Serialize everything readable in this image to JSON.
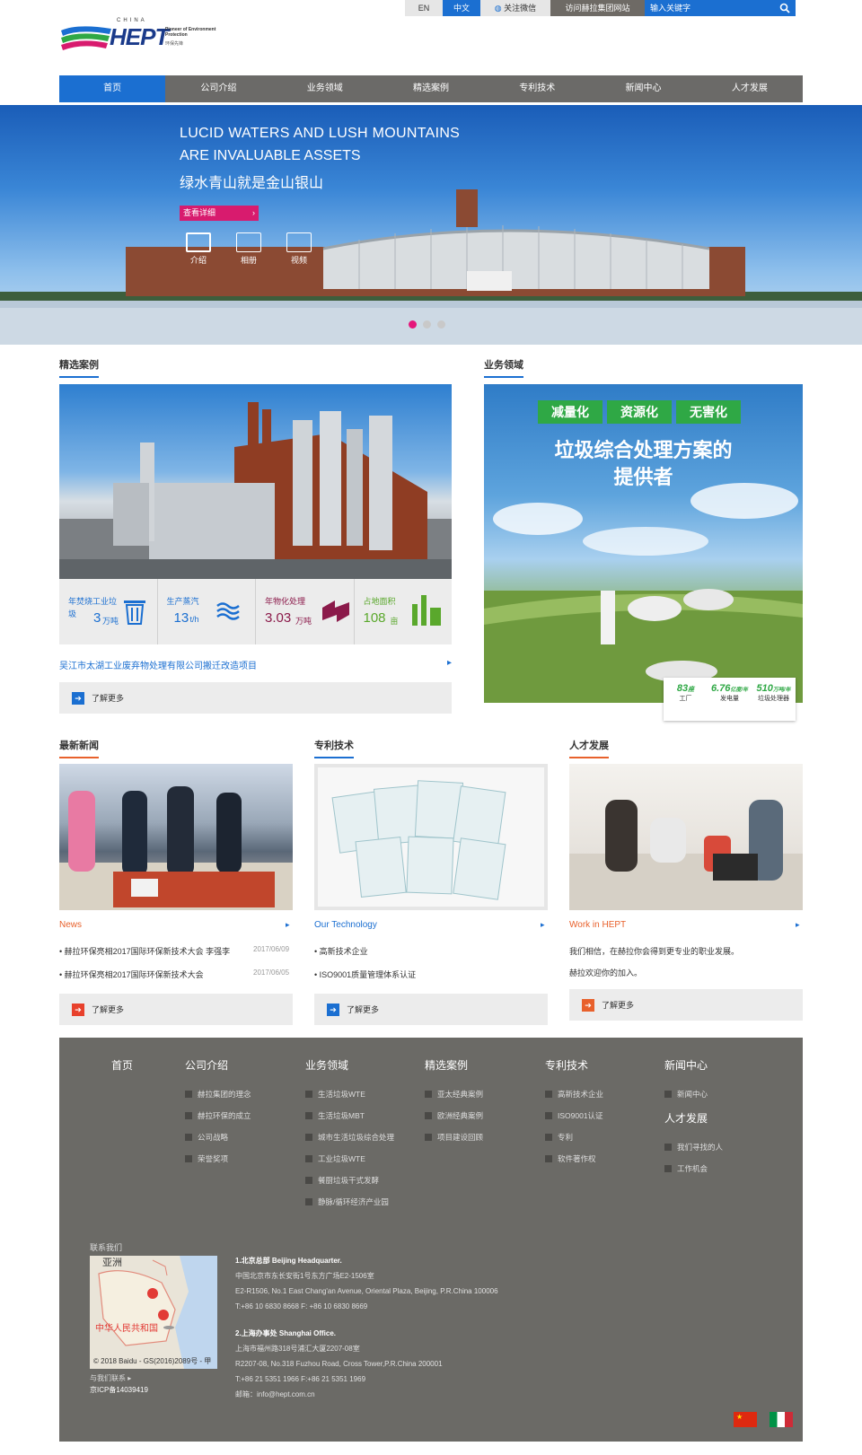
{
  "topbar": {
    "lang_en": "EN",
    "lang_zh": "中文",
    "wechat": "关注微信",
    "visit_group": "访问赫拉集团网站",
    "search_placeholder": "输入关键字"
  },
  "logo": {
    "brand": "HEPT",
    "country": "CHINA",
    "tagline": "Pioneer of Environment Protection",
    "tagline_cn": "环保先锋"
  },
  "nav": [
    "首页",
    "公司介绍",
    "业务领域",
    "精选案例",
    "专利技术",
    "新闻中心",
    "人才发展"
  ],
  "banner": {
    "line1": "LUCID WATERS AND LUSH MOUNTAINS",
    "line2": "ARE INVALUABLE ASSETS",
    "line3": "绿水青山就是金山银山",
    "button": "查看详细",
    "icons": [
      "介绍",
      "相册",
      "视频"
    ]
  },
  "cases": {
    "title": "精选案例",
    "stats": [
      {
        "label": "年焚烧工业垃圾",
        "value": "3",
        "unit": "万吨",
        "prefix": "垃圾"
      },
      {
        "label": "生产蒸汽",
        "value": "13",
        "unit": "t/h"
      },
      {
        "label": "年物化处理",
        "value": "3.03",
        "unit": "万吨"
      },
      {
        "label": "占地面积",
        "value": "108",
        "unit": "亩"
      }
    ],
    "link": "吴江市太湖工业废弃物处理有限公司搬迁改造项目",
    "more": "了解更多"
  },
  "business": {
    "title": "业务领域",
    "tags": [
      "减量化",
      "资源化",
      "无害化"
    ],
    "headline1": "垃圾综合处理方案的",
    "headline2": "提供者",
    "stats": [
      {
        "value": "83",
        "unit": "座",
        "label": "工厂"
      },
      {
        "value": "6.76",
        "unit": "亿度/年",
        "label": "发电量"
      },
      {
        "value": "510",
        "unit": "万吨/年",
        "label": "垃圾处理器"
      }
    ]
  },
  "news": {
    "title": "最新新闻",
    "sub": "News",
    "items": [
      {
        "text": "赫拉环保亮相2017国际环保新技术大会 李强李",
        "date": "2017/06/09"
      },
      {
        "text": "赫拉环保亮相2017国际环保新技术大会",
        "date": "2017/06/05"
      }
    ],
    "more": "了解更多"
  },
  "tech": {
    "title": "专利技术",
    "sub": "Our Technology",
    "items": [
      "高新技术企业",
      "ISO9001质量管理体系认证"
    ],
    "more": "了解更多"
  },
  "hr": {
    "title": "人才发展",
    "sub": "Work in HEPT",
    "line1": "我们相信，在赫拉你会得到更专业的职业发展。",
    "line2": "赫拉欢迎你的加入。",
    "more": "了解更多"
  },
  "footer": {
    "home": "首页",
    "cols": [
      {
        "head": "公司介绍",
        "items": [
          "赫拉集团的理念",
          "赫拉环保的成立",
          "公司战略",
          "荣誉奖项"
        ]
      },
      {
        "head": "业务领域",
        "items": [
          "生活垃圾WTE",
          "生活垃圾MBT",
          "城市生活垃圾综合处理",
          "工业垃圾WTE",
          "餐厨垃圾干式发酵",
          "静脉/循环经济产业园"
        ]
      },
      {
        "head": "精选案例",
        "items": [
          "亚太经典案例",
          "欧洲经典案例",
          "项目建设回顾"
        ]
      },
      {
        "head": "专利技术",
        "items": [
          "高新技术企业",
          "ISO9001认证",
          "专利",
          "软件著作权"
        ]
      },
      {
        "head": "新闻中心",
        "items": [
          "新闻中心"
        ]
      },
      {
        "head": "人才发展",
        "items": [
          "我们寻找的人",
          "工作机会"
        ]
      }
    ],
    "contact_label": "联系我们",
    "map_region": "亚洲",
    "map_country": "中华人民共和国",
    "map_copyright": "© 2018 Baidu - GS(2016)2089号 - 甲",
    "contact_link": "与我们联系",
    "icp": "京ICP备14039419",
    "addr1_title": "1.北京总部 Beijing Headquarter.",
    "addr1_cn": "中国北京市东长安街1号东方广场E2-1506室",
    "addr1_en": "E2-R1506, No.1 East Chang'an Avenue, Oriental Plaza, Beijing, P.R.China 100006",
    "addr1_tel": "T:+86 10 6830 8668   F: +86 10 6830 8669",
    "addr2_title": "2.上海办事处 Shanghai Office.",
    "addr2_cn": "上海市福州路318号浦汇大厦2207-08室",
    "addr2_en": "R2207-08, No.318 Fuzhou Road, Cross Tower,P.R.China 200001",
    "addr2_tel": "T:+86 21 5351 1966   F:+86 21 5351 1969",
    "email": "邮箱：info@hept.com.cn"
  }
}
